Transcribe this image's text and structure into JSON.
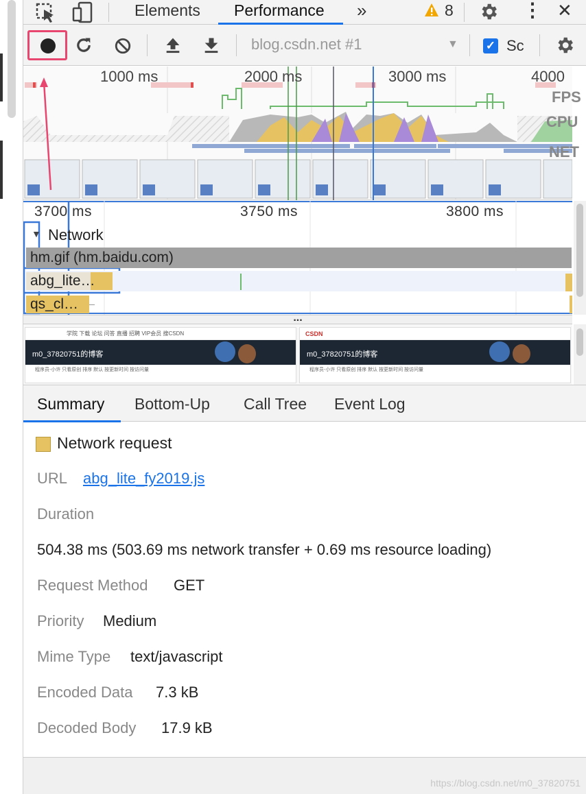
{
  "toolbar": {
    "tabs": [
      "Elements",
      "Performance"
    ],
    "more": "»",
    "warning_count": "8",
    "close": "✕",
    "kebab": "⋮"
  },
  "controls": {
    "target": "blog.csdn.net #1",
    "screenshots_label": "Sc"
  },
  "overview": {
    "ticks": [
      "1000 ms",
      "2000 ms",
      "3000 ms",
      "4000 ms"
    ],
    "lanes": [
      "FPS",
      "CPU",
      "NET"
    ]
  },
  "flame": {
    "ruler": [
      "3700 ms",
      "3750 ms",
      "3800 ms"
    ],
    "section": "Network",
    "requests": [
      "hm.gif (hm.baidu.com)",
      "abg_lite…",
      "qs_cl…"
    ]
  },
  "filmstrip": {
    "blog_title": "m0_37820751的博客",
    "logo": "CSDN",
    "nav": "学院  下载  论坛  问答  直播  招聘  VIP会员        搜CSDN",
    "meta": "程序员-小许    只看原创    排序  默认  按更新时间  按访问量"
  },
  "panel": {
    "tabs": [
      "Summary",
      "Bottom-Up",
      "Call Tree",
      "Event Log"
    ],
    "active_tab": "Summary"
  },
  "summary": {
    "title": "Network request",
    "swatch_color": "#e6c262",
    "url_label": "URL",
    "url": "abg_lite_fy2019.js",
    "duration_label": "Duration",
    "duration": "504.38 ms (503.69 ms network transfer + 0.69 ms resource loading)",
    "method_label": "Request Method",
    "method": "GET",
    "priority_label": "Priority",
    "priority": "Medium",
    "mime_label": "Mime Type",
    "mime": "text/javascript",
    "encoded_label": "Encoded Data",
    "encoded": "7.3 kB",
    "decoded_label": "Decoded Body",
    "decoded": "17.9 kB"
  },
  "watermark": "https://blog.csdn.net/m0_37820751",
  "colors": {
    "accent": "#1a73e8",
    "highlight": "#e8456f",
    "net_request": "#e6c262"
  }
}
